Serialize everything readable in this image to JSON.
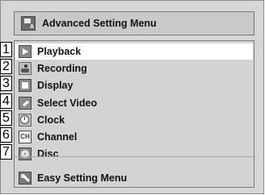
{
  "header": {
    "title": "Advanced Setting Menu",
    "icon": "advanced-setting-icon"
  },
  "menu": {
    "items": [
      {
        "label": "Playback",
        "icon": "play-icon",
        "selected": true
      },
      {
        "label": "Recording",
        "icon": "recording-icon",
        "selected": false
      },
      {
        "label": "Display",
        "icon": "display-icon",
        "selected": false
      },
      {
        "label": "Select Video",
        "icon": "select-video-icon",
        "selected": false
      },
      {
        "label": "Clock",
        "icon": "clock-icon",
        "selected": false
      },
      {
        "label": "Channel",
        "icon": "channel-icon",
        "selected": false
      },
      {
        "label": "Disc",
        "icon": "disc-icon",
        "selected": false
      }
    ],
    "footer_item": {
      "label": "Easy Setting Menu",
      "icon": "wrench-icon"
    }
  },
  "callouts": [
    "1",
    "2",
    "3",
    "4",
    "5",
    "6",
    "7"
  ],
  "colors": {
    "panel": "#d6d6d6",
    "highlight": "#ffffff",
    "text": "#111111"
  }
}
